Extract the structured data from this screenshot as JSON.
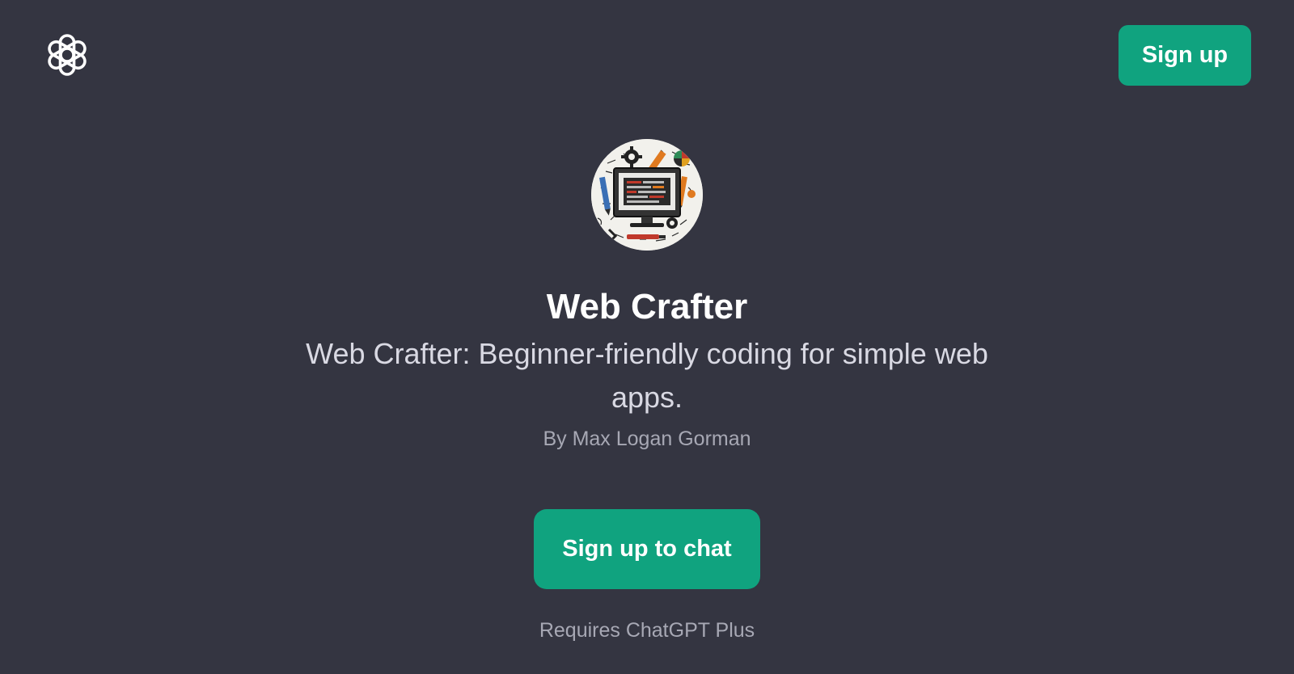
{
  "header": {
    "logo_icon": "openai-logo-icon",
    "signup_label": "Sign up"
  },
  "gpt": {
    "avatar_icon": "web-crafter-avatar",
    "name": "Web Crafter",
    "description": "Web Crafter: Beginner-friendly coding for simple web apps.",
    "author": "By Max Logan Gorman"
  },
  "cta": {
    "label": "Sign up to chat"
  },
  "footer": {
    "requirement": "Requires ChatGPT Plus"
  },
  "colors": {
    "background": "#343541",
    "accent": "#10a37f",
    "text_primary": "#ffffff",
    "text_secondary": "#d9d9e3",
    "text_muted": "#a7a8b4"
  }
}
